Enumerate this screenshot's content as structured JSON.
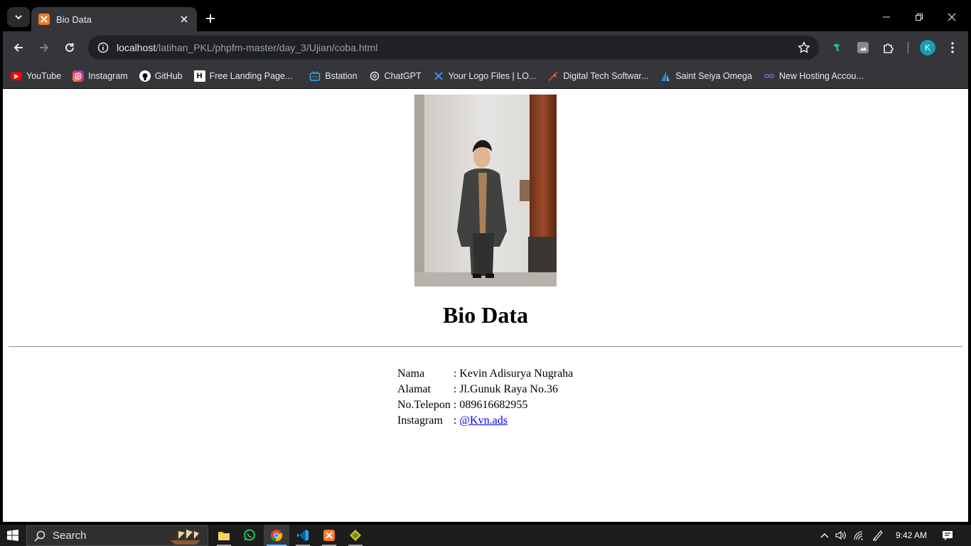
{
  "browser": {
    "tab": {
      "title": "Bio Data"
    },
    "address": {
      "host": "localhost",
      "path": "/latihan_PKL/phpfm-master/day_3/Ujian/coba.html"
    },
    "profile_initial": "K",
    "bookmarks": [
      {
        "label": "YouTube",
        "icon": "youtube-icon"
      },
      {
        "label": "Instagram",
        "icon": "instagram-icon"
      },
      {
        "label": "GitHub",
        "icon": "github-icon"
      },
      {
        "label": "Free Landing Page...",
        "icon": "h-icon"
      },
      {
        "label": "Bstation",
        "icon": "bstation-icon"
      },
      {
        "label": "ChatGPT",
        "icon": "chatgpt-icon"
      },
      {
        "label": "Your Logo Files | LO...",
        "icon": "logo-icon"
      },
      {
        "label": "Digital Tech Softwar...",
        "icon": "digital-tech-icon"
      },
      {
        "label": "Saint Seiya Omega",
        "icon": "saint-seiya-icon"
      },
      {
        "label": "New Hosting Accou...",
        "icon": "infinity-icon"
      }
    ]
  },
  "page": {
    "heading": "Bio Data",
    "rows": [
      {
        "label": "Nama",
        "sep": ":",
        "value": "Kevin Adisurya Nugraha"
      },
      {
        "label": "Alamat",
        "sep": ":",
        "value": "Jl.Gunuk Raya No.36"
      },
      {
        "label": "No.Telepon",
        "sep": ":",
        "value": "089616682955"
      },
      {
        "label": "Instagram",
        "sep": ":",
        "value": "@Kvn.ads",
        "link": true
      }
    ]
  },
  "taskbar": {
    "search_placeholder": "Search",
    "clock": "9:42 AM"
  },
  "colors": {
    "chrome_dark": "#35363a",
    "omnibox": "#202124",
    "link": "#0000ee",
    "profile": "#1a9db0"
  }
}
